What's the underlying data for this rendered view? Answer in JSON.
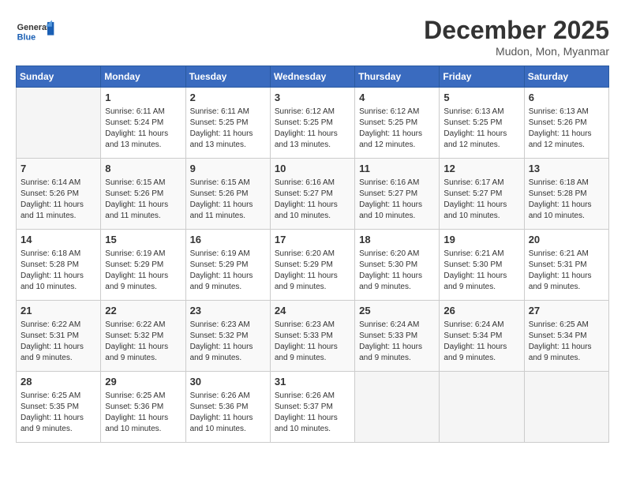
{
  "header": {
    "logo_general": "General",
    "logo_blue": "Blue",
    "month_title": "December 2025",
    "location": "Mudon, Mon, Myanmar"
  },
  "weekdays": [
    "Sunday",
    "Monday",
    "Tuesday",
    "Wednesday",
    "Thursday",
    "Friday",
    "Saturday"
  ],
  "weeks": [
    [
      {
        "day": "",
        "sunrise": "",
        "sunset": "",
        "daylight": ""
      },
      {
        "day": "1",
        "sunrise": "Sunrise: 6:11 AM",
        "sunset": "Sunset: 5:24 PM",
        "daylight": "Daylight: 11 hours and 13 minutes."
      },
      {
        "day": "2",
        "sunrise": "Sunrise: 6:11 AM",
        "sunset": "Sunset: 5:25 PM",
        "daylight": "Daylight: 11 hours and 13 minutes."
      },
      {
        "day": "3",
        "sunrise": "Sunrise: 6:12 AM",
        "sunset": "Sunset: 5:25 PM",
        "daylight": "Daylight: 11 hours and 13 minutes."
      },
      {
        "day": "4",
        "sunrise": "Sunrise: 6:12 AM",
        "sunset": "Sunset: 5:25 PM",
        "daylight": "Daylight: 11 hours and 12 minutes."
      },
      {
        "day": "5",
        "sunrise": "Sunrise: 6:13 AM",
        "sunset": "Sunset: 5:25 PM",
        "daylight": "Daylight: 11 hours and 12 minutes."
      },
      {
        "day": "6",
        "sunrise": "Sunrise: 6:13 AM",
        "sunset": "Sunset: 5:26 PM",
        "daylight": "Daylight: 11 hours and 12 minutes."
      }
    ],
    [
      {
        "day": "7",
        "sunrise": "Sunrise: 6:14 AM",
        "sunset": "Sunset: 5:26 PM",
        "daylight": "Daylight: 11 hours and 11 minutes."
      },
      {
        "day": "8",
        "sunrise": "Sunrise: 6:15 AM",
        "sunset": "Sunset: 5:26 PM",
        "daylight": "Daylight: 11 hours and 11 minutes."
      },
      {
        "day": "9",
        "sunrise": "Sunrise: 6:15 AM",
        "sunset": "Sunset: 5:26 PM",
        "daylight": "Daylight: 11 hours and 11 minutes."
      },
      {
        "day": "10",
        "sunrise": "Sunrise: 6:16 AM",
        "sunset": "Sunset: 5:27 PM",
        "daylight": "Daylight: 11 hours and 10 minutes."
      },
      {
        "day": "11",
        "sunrise": "Sunrise: 6:16 AM",
        "sunset": "Sunset: 5:27 PM",
        "daylight": "Daylight: 11 hours and 10 minutes."
      },
      {
        "day": "12",
        "sunrise": "Sunrise: 6:17 AM",
        "sunset": "Sunset: 5:27 PM",
        "daylight": "Daylight: 11 hours and 10 minutes."
      },
      {
        "day": "13",
        "sunrise": "Sunrise: 6:18 AM",
        "sunset": "Sunset: 5:28 PM",
        "daylight": "Daylight: 11 hours and 10 minutes."
      }
    ],
    [
      {
        "day": "14",
        "sunrise": "Sunrise: 6:18 AM",
        "sunset": "Sunset: 5:28 PM",
        "daylight": "Daylight: 11 hours and 10 minutes."
      },
      {
        "day": "15",
        "sunrise": "Sunrise: 6:19 AM",
        "sunset": "Sunset: 5:29 PM",
        "daylight": "Daylight: 11 hours and 9 minutes."
      },
      {
        "day": "16",
        "sunrise": "Sunrise: 6:19 AM",
        "sunset": "Sunset: 5:29 PM",
        "daylight": "Daylight: 11 hours and 9 minutes."
      },
      {
        "day": "17",
        "sunrise": "Sunrise: 6:20 AM",
        "sunset": "Sunset: 5:29 PM",
        "daylight": "Daylight: 11 hours and 9 minutes."
      },
      {
        "day": "18",
        "sunrise": "Sunrise: 6:20 AM",
        "sunset": "Sunset: 5:30 PM",
        "daylight": "Daylight: 11 hours and 9 minutes."
      },
      {
        "day": "19",
        "sunrise": "Sunrise: 6:21 AM",
        "sunset": "Sunset: 5:30 PM",
        "daylight": "Daylight: 11 hours and 9 minutes."
      },
      {
        "day": "20",
        "sunrise": "Sunrise: 6:21 AM",
        "sunset": "Sunset: 5:31 PM",
        "daylight": "Daylight: 11 hours and 9 minutes."
      }
    ],
    [
      {
        "day": "21",
        "sunrise": "Sunrise: 6:22 AM",
        "sunset": "Sunset: 5:31 PM",
        "daylight": "Daylight: 11 hours and 9 minutes."
      },
      {
        "day": "22",
        "sunrise": "Sunrise: 6:22 AM",
        "sunset": "Sunset: 5:32 PM",
        "daylight": "Daylight: 11 hours and 9 minutes."
      },
      {
        "day": "23",
        "sunrise": "Sunrise: 6:23 AM",
        "sunset": "Sunset: 5:32 PM",
        "daylight": "Daylight: 11 hours and 9 minutes."
      },
      {
        "day": "24",
        "sunrise": "Sunrise: 6:23 AM",
        "sunset": "Sunset: 5:33 PM",
        "daylight": "Daylight: 11 hours and 9 minutes."
      },
      {
        "day": "25",
        "sunrise": "Sunrise: 6:24 AM",
        "sunset": "Sunset: 5:33 PM",
        "daylight": "Daylight: 11 hours and 9 minutes."
      },
      {
        "day": "26",
        "sunrise": "Sunrise: 6:24 AM",
        "sunset": "Sunset: 5:34 PM",
        "daylight": "Daylight: 11 hours and 9 minutes."
      },
      {
        "day": "27",
        "sunrise": "Sunrise: 6:25 AM",
        "sunset": "Sunset: 5:34 PM",
        "daylight": "Daylight: 11 hours and 9 minutes."
      }
    ],
    [
      {
        "day": "28",
        "sunrise": "Sunrise: 6:25 AM",
        "sunset": "Sunset: 5:35 PM",
        "daylight": "Daylight: 11 hours and 9 minutes."
      },
      {
        "day": "29",
        "sunrise": "Sunrise: 6:25 AM",
        "sunset": "Sunset: 5:36 PM",
        "daylight": "Daylight: 11 hours and 10 minutes."
      },
      {
        "day": "30",
        "sunrise": "Sunrise: 6:26 AM",
        "sunset": "Sunset: 5:36 PM",
        "daylight": "Daylight: 11 hours and 10 minutes."
      },
      {
        "day": "31",
        "sunrise": "Sunrise: 6:26 AM",
        "sunset": "Sunset: 5:37 PM",
        "daylight": "Daylight: 11 hours and 10 minutes."
      },
      {
        "day": "",
        "sunrise": "",
        "sunset": "",
        "daylight": ""
      },
      {
        "day": "",
        "sunrise": "",
        "sunset": "",
        "daylight": ""
      },
      {
        "day": "",
        "sunrise": "",
        "sunset": "",
        "daylight": ""
      }
    ]
  ]
}
